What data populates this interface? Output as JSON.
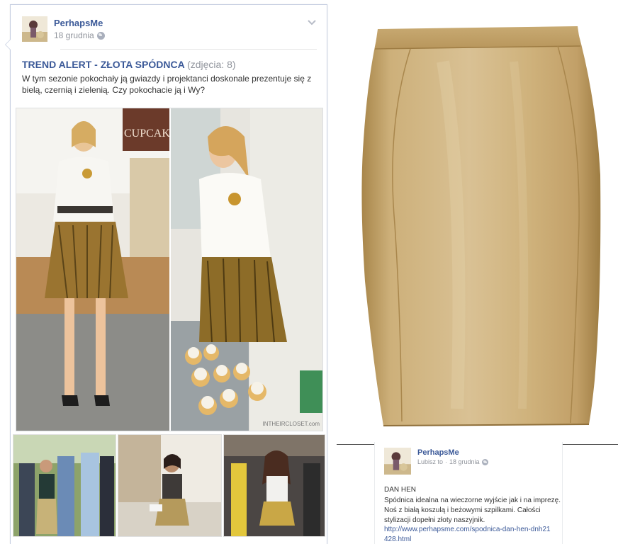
{
  "post": {
    "author": "PerhapsMe",
    "date": "18 grudnia",
    "title": "TREND ALERT - ZŁOTA SPÓDNCA",
    "photo_count": "(zdjęcia: 8)",
    "text": "W tym sezonie pokochały ją gwiazdy i projektanci doskonale prezentuje się z bielą, czernią i zielenią. Czy pokochacie ją i Wy?",
    "photo_credit": "INTHEIRCLOSET.com",
    "main_photo_sign": "CUPCAKE"
  },
  "product_post": {
    "author": "PerhapsMe",
    "like_label": "Lubisz to",
    "separator": "·",
    "date": "18 grudnia",
    "product_name": "DAN HEN",
    "description": "Spódnica idealna na wieczorne wyjście jak i na imprezę. Noś z białą koszulą i beżowymi szpilkami. Całości stylizacji dopełni złoty naszyjnik.",
    "link": "http://www.perhapsme.com/spodnica-dan-hen-dnh21428.html"
  },
  "icons": {
    "privacy": "globe-icon",
    "menu": "chevron-down-icon"
  },
  "colors": {
    "link": "#3b5998",
    "meta": "#90949c",
    "gold": "#c9a86c"
  }
}
